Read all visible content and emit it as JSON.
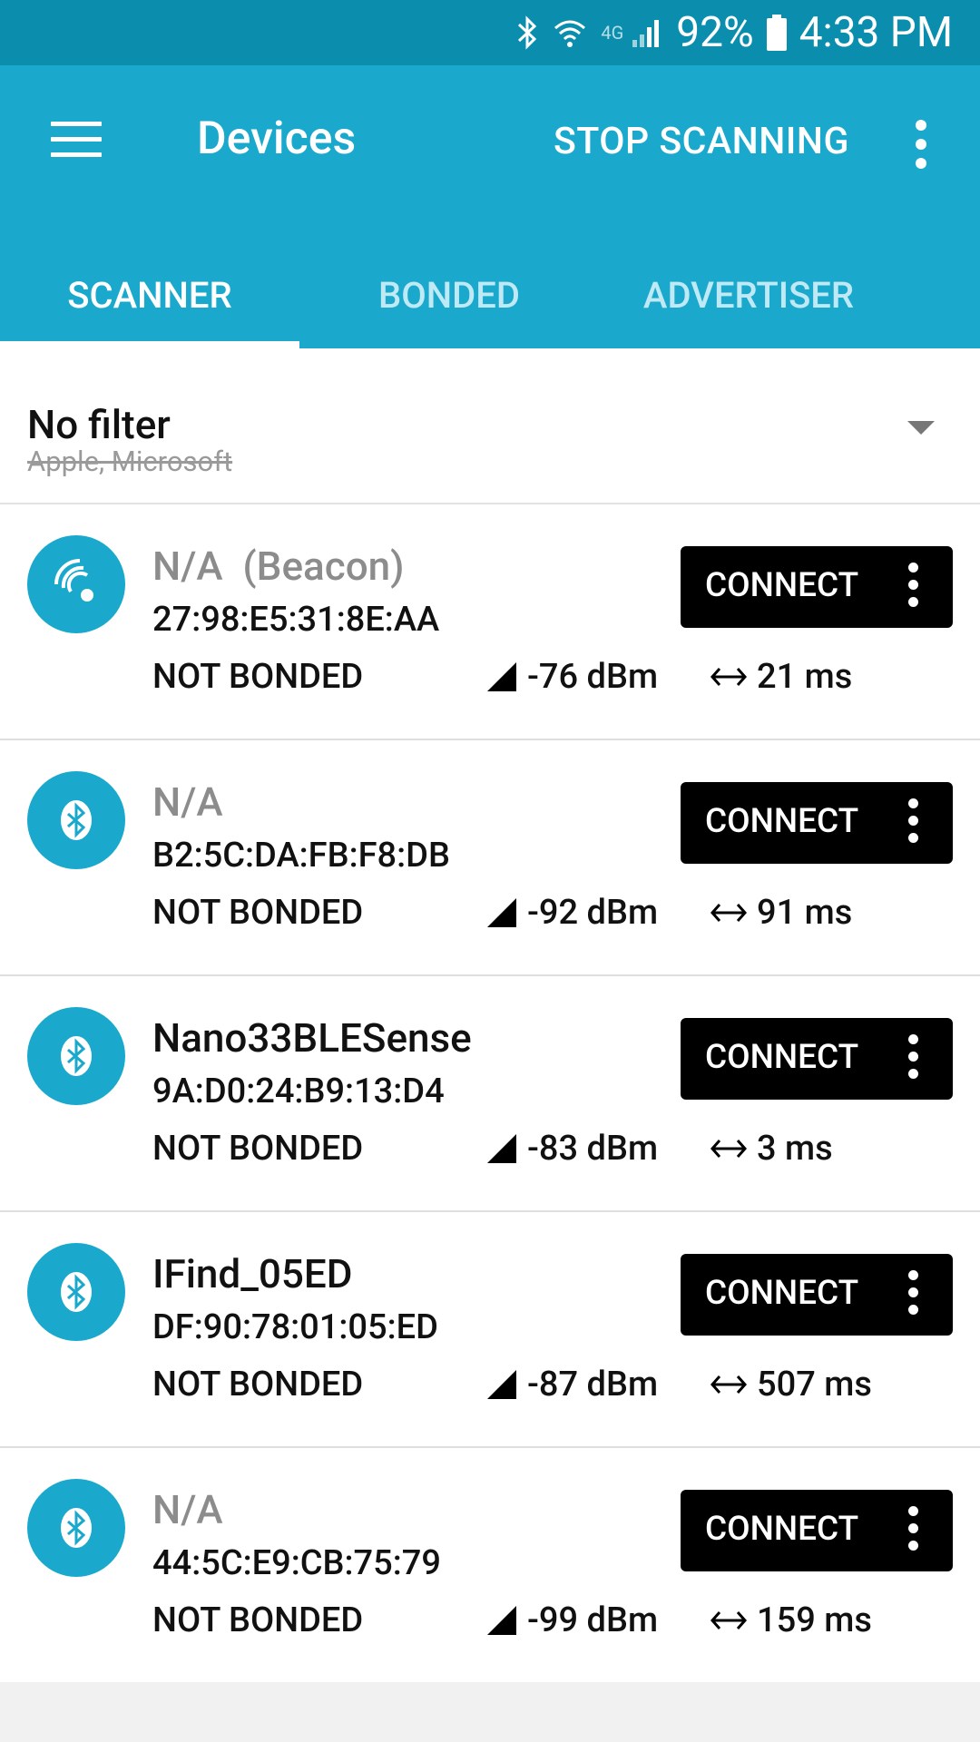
{
  "status_bar": {
    "battery": "92%",
    "time": "4:33 PM",
    "network_label": "4G",
    "icons": [
      "bluetooth-icon",
      "wifi-icon",
      "signal-icon",
      "battery-icon"
    ]
  },
  "app_bar": {
    "title": "Devices",
    "action": "STOP SCANNING"
  },
  "tabs": [
    {
      "label": "SCANNER",
      "active": true
    },
    {
      "label": "BONDED",
      "active": false
    },
    {
      "label": "ADVERTISER",
      "active": false
    }
  ],
  "filter": {
    "title": "No filter",
    "subtitle": "Apple, Microsoft"
  },
  "devices": [
    {
      "name": "N/A  (Beacon)",
      "mac": "27:98:E5:31:8E:AA",
      "bond": "NOT BONDED",
      "rssi": "-76 dBm",
      "interval": "21 ms",
      "icon": "beacon-icon",
      "button": "CONNECT"
    },
    {
      "name": "N/A",
      "mac": "B2:5C:DA:FB:F8:DB",
      "bond": "NOT BONDED",
      "rssi": "-92 dBm",
      "interval": "91 ms",
      "icon": "bluetooth-icon",
      "button": "CONNECT"
    },
    {
      "name": "Nano33BLESense",
      "mac": "9A:D0:24:B9:13:D4",
      "bond": "NOT BONDED",
      "rssi": "-83 dBm",
      "interval": "3 ms",
      "icon": "bluetooth-icon",
      "button": "CONNECT"
    },
    {
      "name": "IFind_05ED",
      "mac": "DF:90:78:01:05:ED",
      "bond": "NOT BONDED",
      "rssi": "-87 dBm",
      "interval": "507 ms",
      "icon": "bluetooth-icon",
      "button": "CONNECT"
    },
    {
      "name": "N/A",
      "mac": "44:5C:E9:CB:75:79",
      "bond": "NOT BONDED",
      "rssi": "-99 dBm",
      "interval": "159 ms",
      "icon": "bluetooth-icon",
      "button": "CONNECT"
    }
  ],
  "colors": {
    "status_bar": "#0b8eae",
    "primary": "#1aa9cd",
    "button": "#000000"
  }
}
